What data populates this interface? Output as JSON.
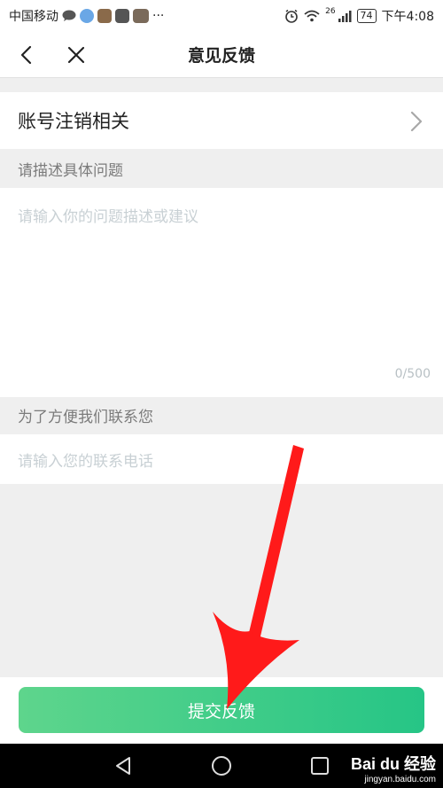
{
  "status_bar": {
    "carrier": "中国移动",
    "more": "···",
    "network": "26",
    "battery": "74",
    "time": "下午4:08"
  },
  "header": {
    "title": "意见反馈"
  },
  "category": {
    "label": "账号注销相关"
  },
  "describe_section": {
    "label": "请描述具体问题",
    "placeholder": "请输入你的问题描述或建议",
    "counter": "0/500"
  },
  "contact_section": {
    "label": "为了方便我们联系您",
    "placeholder": "请输入您的联系电话"
  },
  "submit": {
    "label": "提交反馈"
  },
  "watermark": {
    "brand": "Bai du 经验",
    "url": "jingyan.baidu.com"
  },
  "colors": {
    "accent_start": "#5ed58c",
    "accent_end": "#26c586",
    "annotation_arrow": "#ff1a1a"
  }
}
